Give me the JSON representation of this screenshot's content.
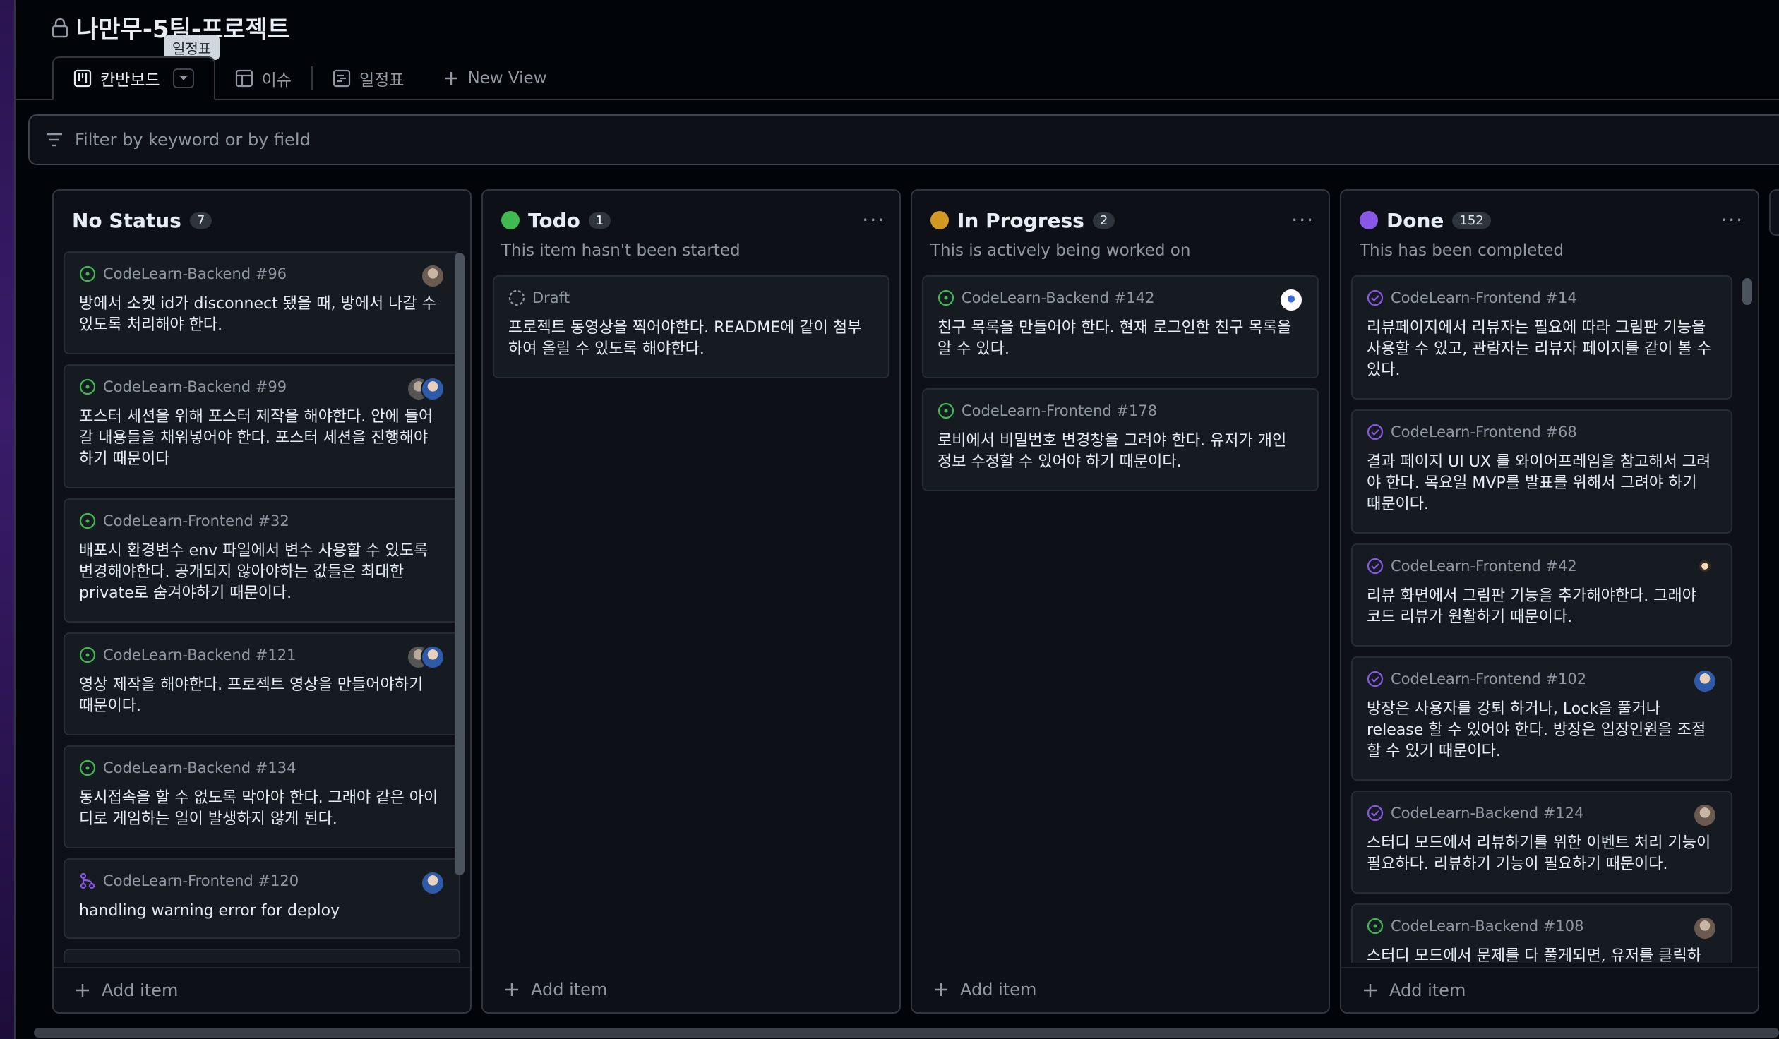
{
  "project": {
    "title": "나만무-5팀-프로젝트"
  },
  "tooltip": "일정표",
  "views": [
    {
      "label": "칸반보드"
    },
    {
      "label": "이슈"
    },
    {
      "label": "일정표"
    },
    {
      "label": "New View"
    }
  ],
  "filter": {
    "placeholder": "Filter by keyword or by field"
  },
  "colors": {
    "todo": "#3fb950",
    "in_progress": "#d29922",
    "done": "#8957e5",
    "open": "#3fb950",
    "closed": "#8957e5"
  },
  "columns": [
    {
      "name": "No Status",
      "count": "7",
      "description": "",
      "cards": [
        {
          "meta": "CodeLearn-Backend #96",
          "title": "방에서 소켓 id가 disconnect 됐을 때, 방에서 나갈 수 있도록 처리해야 한다.",
          "status": "open-issue-icon"
        },
        {
          "meta": "CodeLearn-Backend #99",
          "title": "포스터 세션을 위해 포스터 제작을 해야한다. 안에 들어갈 내용들을 채워넣어야 한다. 포스터 세션을 진행해야 하기 때문이다",
          "status": "open-issue-icon"
        },
        {
          "meta": "CodeLearn-Frontend #32",
          "title": "배포시 환경변수 env 파일에서 변수 사용할 수 있도록 변경해야한다. 공개되지 않아야하는 값들은 최대한 private로 숨겨야하기 때문이다.",
          "status": "open-issue-icon"
        },
        {
          "meta": "CodeLearn-Backend #121",
          "title": "영상 제작을 해야한다. 프로젝트 영상을 만들어야하기 때문이다.",
          "status": "open-issue-icon"
        },
        {
          "meta": "CodeLearn-Backend #134",
          "title": "동시접속을 할 수 없도록 막아야 한다. 그래야 같은 아이디로 게임하는 일이 발생하지 않게 된다.",
          "status": "open-issue-icon"
        },
        {
          "meta": "CodeLearn-Frontend #120",
          "title": "handling warning error for deploy",
          "status": "pull-request-icon"
        }
      ],
      "add_item": "Add item"
    },
    {
      "name": "Todo",
      "count": "1",
      "description": "This item hasn't been started",
      "cards": [
        {
          "meta": "Draft",
          "title": "프로젝트 동영상을 찍어야한다. README에 같이 첨부하여 올릴 수 있도록 해야한다.",
          "status": "draft-icon"
        }
      ],
      "add_item": "Add item"
    },
    {
      "name": "In Progress",
      "count": "2",
      "description": "This is actively being worked on",
      "cards": [
        {
          "meta": "CodeLearn-Backend #142",
          "title": "친구 목록을 만들어야 한다. 현재 로그인한 친구 목록을 알 수 있다.",
          "status": "open-issue-icon"
        },
        {
          "meta": "CodeLearn-Frontend #178",
          "title": "로비에서 비밀번호 변경창을 그려야 한다. 유저가 개인정보 수정할 수 있어야 하기 때문이다.",
          "status": "open-issue-icon"
        }
      ],
      "add_item": "Add item"
    },
    {
      "name": "Done",
      "count": "152",
      "description": "This has been completed",
      "cards": [
        {
          "meta": "CodeLearn-Frontend #14",
          "title": "리뷰페이지에서 리뷰자는 필요에 따라 그림판 기능을 사용할 수 있고, 관람자는 리뷰자 페이지를 같이 볼 수 있다.",
          "status": "closed-issue-icon"
        },
        {
          "meta": "CodeLearn-Frontend #68",
          "title": "결과 페이지 UI UX 를 와이어프레임을 참고해서 그려야 한다. 목요일 MVP를 발표를 위해서 그려야 하기 때문이다.",
          "status": "closed-issue-icon"
        },
        {
          "meta": "CodeLearn-Frontend #42",
          "title": "리뷰 화면에서 그림판 기능을 추가해야한다. 그래야 코드 리뷰가 원활하기 때문이다.",
          "status": "closed-issue-icon"
        },
        {
          "meta": "CodeLearn-Frontend #102",
          "title": "방장은 사용자를 강퇴 하거나, Lock을 풀거나 release 할 수 있어야 한다. 방장은 입장인원을 조절할 수 있기 때문이다.",
          "status": "closed-issue-icon"
        },
        {
          "meta": "CodeLearn-Backend #124",
          "title": "스터디 모드에서 리뷰하기를 위한 이벤트 처리 기능이 필요하다. 리뷰하기 기능이 필요하기 때문이다.",
          "status": "closed-issue-icon"
        },
        {
          "meta": "CodeLearn-Backend #108",
          "title": "스터디 모드에서 문제를 다 풀게되면, 유저를 클릭하",
          "status": "closed-issue-icon"
        }
      ],
      "add_item": "Add item"
    }
  ]
}
